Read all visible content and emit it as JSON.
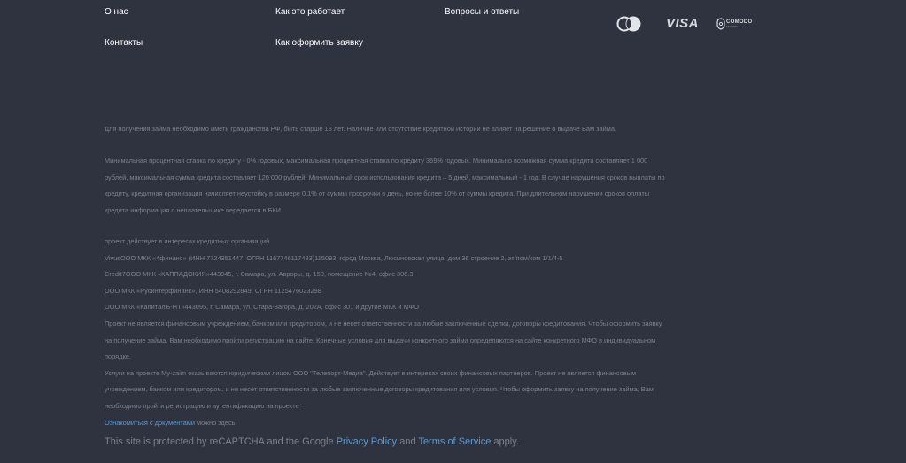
{
  "nav": {
    "about": "О нас",
    "how_it_works": "Как это работает",
    "faq": "Вопросы и ответы",
    "contacts": "Контакты",
    "how_to_apply": "Как оформить заявку"
  },
  "payment_logos": {
    "mastercard": "mastercard-icon",
    "visa": "VISA",
    "comodo": "COMODO",
    "comodo_sub": "SECURE"
  },
  "legal": {
    "citizenship": "Для получения займа необходимо иметь гражданства РФ, быть старше 18 лет. Наличие или отсутствие кредитной истории не влияет на решение о выдаче Вам займа.",
    "rates_lines": [
      "Минимальная процентная ставка по кредиту - 0% годовых, максимальная процентная ставка по кредиту 359% годовых. Минимально возможная сумма кредита составляет 1 000",
      "рублей, максимальная сумма кредита составляет 120 000 рублей. Минимальный срок использования кредита – 5 дней, максимальный - 1 год. В случае нарушения сроков выплаты по",
      "кредиту, кредитная организация начисляет неустойку в размере 0,1% от суммы просрочки в день, но не более 10% от суммы кредита. При длительном нарушении сроков оплаты",
      "кредита информация о неплательщике передается в БКИ."
    ],
    "orgs_lines": [
      "проект действует в интересах кредитных организаций",
      "VivusООО МКК «4финанс» (ИНН 7724351447, ОГРН 1167746117483)115093, город Москва, Люсиновская улица, дом 36 строение 2, эт/пом/ком 1/1/4-5",
      "Credit7ООО МКК «КАППАДОКИЯ»443045, г. Самара, ул. Авроры, д. 150, помещение №4, офис 306.3",
      "ООО МКК «Русинтерфинанс», ИНН 5408292849, ОГРН 1125476023298",
      "ООО МКК «КапиталЪ-НТ»443095, г. Самара, ул. Стара-Загора, д. 202А, офис 301 и другие МКК и МФО",
      "Проект не является финансовым учреждением, банком или кредитором, и не несет ответственности за любые заключенные сделки, договоры кредитования. Чтобы оформить заявку",
      "на получение займа, Вам необходимо пройти регистрацию на сайте. Конечные условия для выдачи конкретного займа определяются на сайте конкретного МФО в индивидуальном",
      "порядке.",
      "Услуги на проекте My-zaim оказываются юридическим лицом ООО \"Телепорт-Медиа\". Действует в интересах своих финансовых партнеров. Проект не является финансовым",
      "учреждением, банком или кредитором, и не несёт ответственности за любые заключенные договоры кредитования или условия. Чтобы оформить заявку на получение займа, Вам",
      "необходимо пройти регистрацию и аутентификацию на проекте"
    ],
    "docs_link": "Ознакомиться с документами",
    "docs_suffix": " можно здесь"
  },
  "recaptcha": {
    "prefix": "This site is protected by reCAPTCHA and the Google ",
    "privacy": "Privacy Policy",
    "and": " and ",
    "terms": "Terms of Service",
    "suffix": " apply."
  }
}
